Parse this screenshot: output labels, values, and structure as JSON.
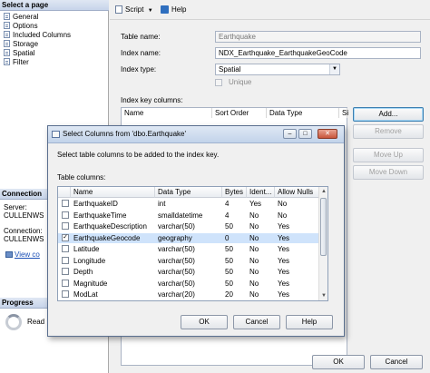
{
  "left": {
    "select_header": "Select a page",
    "pages": [
      "General",
      "Options",
      "Included Columns",
      "Storage",
      "Spatial",
      "Filter"
    ],
    "connection_header": "Connection",
    "connection_lines": [
      "Server:",
      "CULLENWS",
      "Connection:",
      "CULLENWS"
    ],
    "view_link": "View co",
    "progress_header": "Progress",
    "progress_status": "Read"
  },
  "toolbar": {
    "script": "Script",
    "help": "Help"
  },
  "form": {
    "table_name_label": "Table name:",
    "table_name_value": "Earthquake",
    "index_name_label": "Index name:",
    "index_name_value": "NDX_Earthquake_EarthquakeGeoCode",
    "index_type_label": "Index type:",
    "index_type_value": "Spatial",
    "unique_label": "Unique",
    "key_columns_label": "Index key columns:",
    "key_headers": [
      "Name",
      "Sort Order",
      "Data Type",
      "Si"
    ]
  },
  "side_buttons": {
    "add": "Add...",
    "remove": "Remove",
    "move_up": "Move Up",
    "move_down": "Move Down"
  },
  "dialog": {
    "title": "Select Columns from 'dbo.Earthquake'",
    "description": "Select table columns to be added to the index key.",
    "table_label": "Table columns:",
    "headers": [
      "",
      "Name",
      "Data Type",
      "Bytes",
      "Ident...",
      "Allow Nulls"
    ],
    "rows": [
      {
        "checked": false,
        "name": "EarthquakeID",
        "type": "int",
        "bytes": "4",
        "ident": "Yes",
        "nulls": "No"
      },
      {
        "checked": false,
        "name": "EarthquakeTime",
        "type": "smalldatetime",
        "bytes": "4",
        "ident": "No",
        "nulls": "No"
      },
      {
        "checked": false,
        "name": "EarthquakeDescription",
        "type": "varchar(50)",
        "bytes": "50",
        "ident": "No",
        "nulls": "Yes"
      },
      {
        "checked": true,
        "name": "EarthquakeGeocode",
        "type": "geography",
        "bytes": "0",
        "ident": "No",
        "nulls": "Yes"
      },
      {
        "checked": false,
        "name": "Latitude",
        "type": "varchar(50)",
        "bytes": "50",
        "ident": "No",
        "nulls": "Yes"
      },
      {
        "checked": false,
        "name": "Longitude",
        "type": "varchar(50)",
        "bytes": "50",
        "ident": "No",
        "nulls": "Yes"
      },
      {
        "checked": false,
        "name": "Depth",
        "type": "varchar(50)",
        "bytes": "50",
        "ident": "No",
        "nulls": "Yes"
      },
      {
        "checked": false,
        "name": "Magnitude",
        "type": "varchar(50)",
        "bytes": "50",
        "ident": "No",
        "nulls": "Yes"
      },
      {
        "checked": false,
        "name": "ModLat",
        "type": "varchar(20)",
        "bytes": "20",
        "ident": "No",
        "nulls": "Yes"
      }
    ],
    "ok": "OK",
    "cancel": "Cancel",
    "help": "Help"
  },
  "bottom_buttons": {
    "ok": "OK",
    "cancel": "Cancel"
  },
  "colors": {
    "selected_row": "#cfe3fb",
    "header_gradient": "#c7d4ea",
    "link": "#1a4fb5"
  }
}
